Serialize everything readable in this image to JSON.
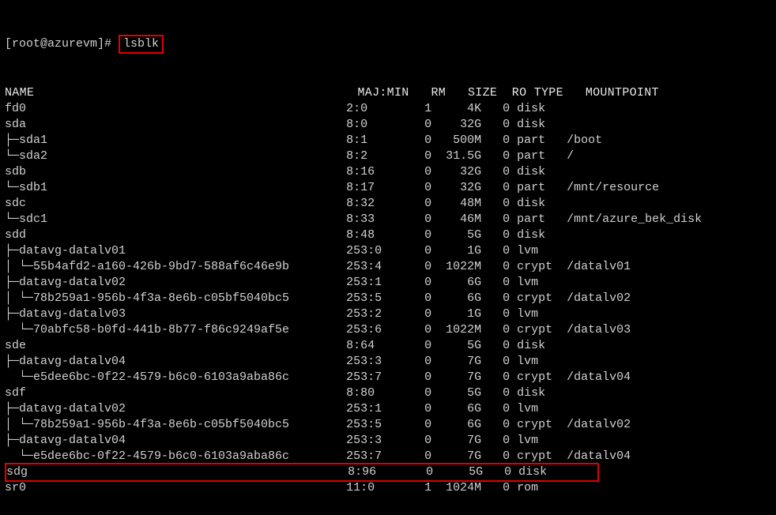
{
  "prompt": {
    "user_host": "[root@azurevm]# ",
    "command": "lsblk"
  },
  "header": {
    "name": "NAME",
    "majmin": "MAJ:MIN",
    "rm": "RM",
    "size": "SIZE",
    "ro": "RO",
    "type": "TYPE",
    "mount": "MOUNTPOINT"
  },
  "rows": [
    {
      "name": "fd0",
      "majmin": "2:0",
      "rm": "1",
      "size": "4K",
      "ro": "0",
      "type": "disk",
      "mount": ""
    },
    {
      "name": "sda",
      "majmin": "8:0",
      "rm": "0",
      "size": "32G",
      "ro": "0",
      "type": "disk",
      "mount": ""
    },
    {
      "name": "├─sda1",
      "majmin": "8:1",
      "rm": "0",
      "size": "500M",
      "ro": "0",
      "type": "part",
      "mount": "/boot"
    },
    {
      "name": "└─sda2",
      "majmin": "8:2",
      "rm": "0",
      "size": "31.5G",
      "ro": "0",
      "type": "part",
      "mount": "/"
    },
    {
      "name": "sdb",
      "majmin": "8:16",
      "rm": "0",
      "size": "32G",
      "ro": "0",
      "type": "disk",
      "mount": ""
    },
    {
      "name": "└─sdb1",
      "majmin": "8:17",
      "rm": "0",
      "size": "32G",
      "ro": "0",
      "type": "part",
      "mount": "/mnt/resource"
    },
    {
      "name": "sdc",
      "majmin": "8:32",
      "rm": "0",
      "size": "48M",
      "ro": "0",
      "type": "disk",
      "mount": ""
    },
    {
      "name": "└─sdc1",
      "majmin": "8:33",
      "rm": "0",
      "size": "46M",
      "ro": "0",
      "type": "part",
      "mount": "/mnt/azure_bek_disk"
    },
    {
      "name": "sdd",
      "majmin": "8:48",
      "rm": "0",
      "size": "5G",
      "ro": "0",
      "type": "disk",
      "mount": ""
    },
    {
      "name": "├─datavg-datalv01",
      "majmin": "253:0",
      "rm": "0",
      "size": "1G",
      "ro": "0",
      "type": "lvm",
      "mount": ""
    },
    {
      "name": "│ └─55b4afd2-a160-426b-9bd7-588af6c46e9b",
      "majmin": "253:4",
      "rm": "0",
      "size": "1022M",
      "ro": "0",
      "type": "crypt",
      "mount": "/datalv01"
    },
    {
      "name": "├─datavg-datalv02",
      "majmin": "253:1",
      "rm": "0",
      "size": "6G",
      "ro": "0",
      "type": "lvm",
      "mount": ""
    },
    {
      "name": "│ └─78b259a1-956b-4f3a-8e6b-c05bf5040bc5",
      "majmin": "253:5",
      "rm": "0",
      "size": "6G",
      "ro": "0",
      "type": "crypt",
      "mount": "/datalv02"
    },
    {
      "name": "├─datavg-datalv03",
      "majmin": "253:2",
      "rm": "0",
      "size": "1G",
      "ro": "0",
      "type": "lvm",
      "mount": ""
    },
    {
      "name": "  └─70abfc58-b0fd-441b-8b77-f86c9249af5e",
      "majmin": "253:6",
      "rm": "0",
      "size": "1022M",
      "ro": "0",
      "type": "crypt",
      "mount": "/datalv03"
    },
    {
      "name": "sde",
      "majmin": "8:64",
      "rm": "0",
      "size": "5G",
      "ro": "0",
      "type": "disk",
      "mount": ""
    },
    {
      "name": "├─datavg-datalv04",
      "majmin": "253:3",
      "rm": "0",
      "size": "7G",
      "ro": "0",
      "type": "lvm",
      "mount": ""
    },
    {
      "name": "  └─e5dee6bc-0f22-4579-b6c0-6103a9aba86c",
      "majmin": "253:7",
      "rm": "0",
      "size": "7G",
      "ro": "0",
      "type": "crypt",
      "mount": "/datalv04"
    },
    {
      "name": "sdf",
      "majmin": "8:80",
      "rm": "0",
      "size": "5G",
      "ro": "0",
      "type": "disk",
      "mount": ""
    },
    {
      "name": "├─datavg-datalv02",
      "majmin": "253:1",
      "rm": "0",
      "size": "6G",
      "ro": "0",
      "type": "lvm",
      "mount": ""
    },
    {
      "name": "│ └─78b259a1-956b-4f3a-8e6b-c05bf5040bc5",
      "majmin": "253:5",
      "rm": "0",
      "size": "6G",
      "ro": "0",
      "type": "crypt",
      "mount": "/datalv02"
    },
    {
      "name": "├─datavg-datalv04",
      "majmin": "253:3",
      "rm": "0",
      "size": "7G",
      "ro": "0",
      "type": "lvm",
      "mount": ""
    },
    {
      "name": "  └─e5dee6bc-0f22-4579-b6c0-6103a9aba86c",
      "majmin": "253:7",
      "rm": "0",
      "size": "7G",
      "ro": "0",
      "type": "crypt",
      "mount": "/datalv04"
    },
    {
      "name": "sdg",
      "majmin": "8:96",
      "rm": "0",
      "size": "5G",
      "ro": "0",
      "type": "disk",
      "mount": "",
      "highlight": true
    },
    {
      "name": "sr0",
      "majmin": "11:0",
      "rm": "1",
      "size": "1024M",
      "ro": "0",
      "type": "rom",
      "mount": ""
    }
  ],
  "col_widths": {
    "name": 48,
    "majmin": 8,
    "rm": 4,
    "size": 7,
    "ro": 4,
    "type": 6,
    "mount": 0
  }
}
